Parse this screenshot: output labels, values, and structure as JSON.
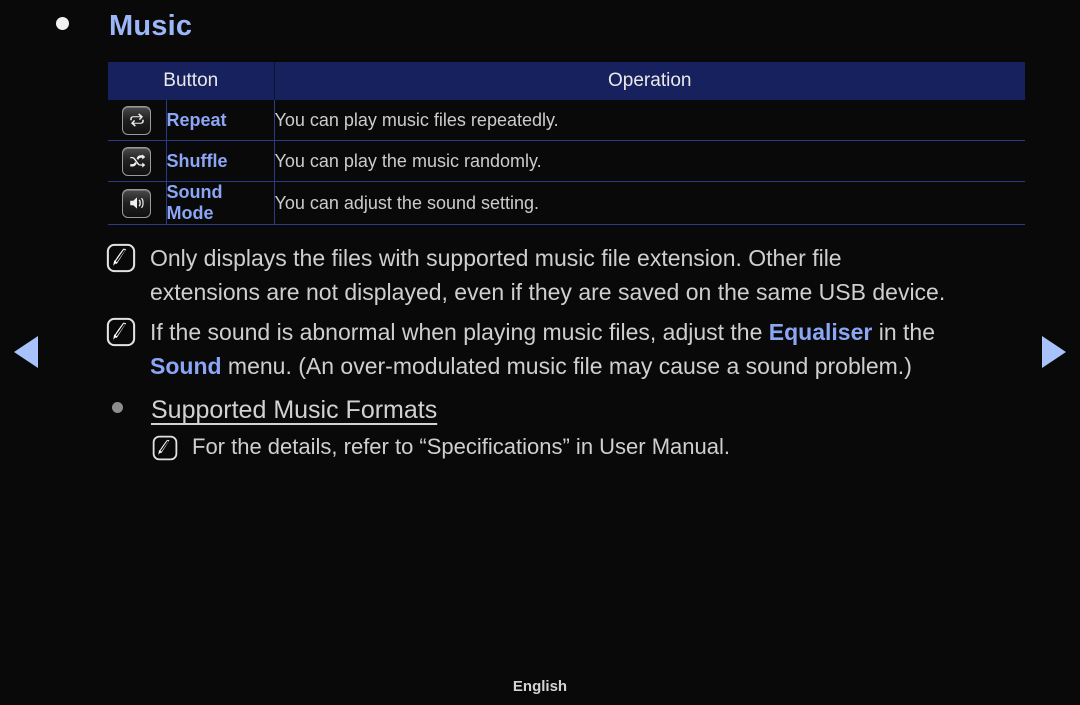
{
  "page": {
    "section_bullet_icon": "bullet-dot-icon",
    "title": "Music",
    "footer_language": "English",
    "accent_blue": "#8aa6f5",
    "header_navy": "#17215e",
    "title_blue": "#9db6f8",
    "body_gray": "#cfcfcf",
    "background": "#090909"
  },
  "nav": {
    "prev_icon": "triangle-left-icon",
    "next_icon": "triangle-right-icon",
    "arrow_color": "#a8c2fb"
  },
  "table": {
    "headers": {
      "button": "Button",
      "operation": "Operation"
    },
    "rows": [
      {
        "icon": "repeat-icon",
        "label": "Repeat",
        "operation": "You can play music files repeatedly."
      },
      {
        "icon": "shuffle-icon",
        "label": "Shuffle",
        "operation": "You can play the music randomly."
      },
      {
        "icon": "sound-volume-icon",
        "label": "Sound Mode",
        "operation": "You can adjust the sound setting."
      }
    ]
  },
  "notes": [
    {
      "icon": "note-pen-icon",
      "line1": "Only displays the files with supported music file extension. Other file",
      "line2": "extensions are not displayed, even if they are saved on the same USB device."
    },
    {
      "icon": "note-pen-icon",
      "line1_a": "If the sound is abnormal when playing music files, adjust the ",
      "line1_b": "Equaliser",
      "line1_c": " in the",
      "line2_a": "Sound",
      "line2_b": " menu. (An over-modulated music file may cause a sound problem.)"
    }
  ],
  "formats": {
    "bullet_icon": "bullet-dot-icon",
    "title": "Supported Music Formats",
    "note": {
      "icon": "note-pen-icon",
      "text": "For the details, refer to “Specifications” in User Manual."
    }
  }
}
